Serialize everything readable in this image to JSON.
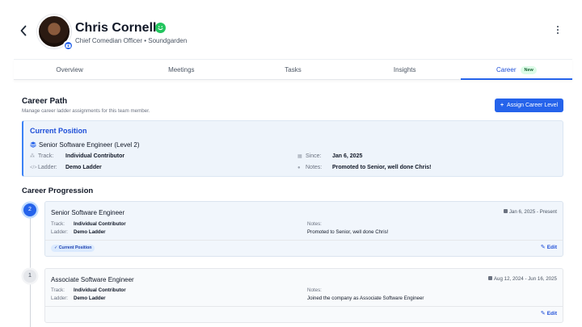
{
  "profile": {
    "name": "Chris Cornell",
    "subtitle": "Chief Comedian Officer • Soundgarden"
  },
  "tabs": [
    {
      "label": "Overview"
    },
    {
      "label": "Meetings"
    },
    {
      "label": "Tasks"
    },
    {
      "label": "Insights"
    },
    {
      "label": "Career",
      "badge": "New",
      "active": true
    }
  ],
  "career_path": {
    "title": "Career Path",
    "subtitle": "Manage career ladder assignments for this team member.",
    "assign_button": "Assign Career Level"
  },
  "current_position": {
    "title": "Current Position",
    "level": "Senior Software Engineer (Level 2)",
    "track_label": "Track:",
    "track": "Individual Contributor",
    "ladder_label": "Ladder:",
    "ladder": "Demo Ladder",
    "since_label": "Since:",
    "since": "Jan 6, 2025",
    "notes_label": "Notes:",
    "notes": "Promoted to Senior, well done Chris!"
  },
  "progression": {
    "title": "Career Progression",
    "items": [
      {
        "step": "2",
        "role": "Senior Software Engineer",
        "dates": "Jan 6, 2025 - Present",
        "track_label": "Track:",
        "track": "Individual Contributor",
        "ladder_label": "Ladder:",
        "ladder": "Demo Ladder",
        "notes_label": "Notes:",
        "notes": "Promoted to Senior, well done Chris!",
        "badge": "Current Position",
        "edit": "Edit"
      },
      {
        "step": "1",
        "role": "Associate Software Engineer",
        "dates": "Aug 12, 2024 - Jun 16, 2025",
        "track_label": "Track:",
        "track": "Individual Contributor",
        "ladder_label": "Ladder:",
        "ladder": "Demo Ladder",
        "notes_label": "Notes:",
        "notes": "Joined the company as Associate Software Engineer",
        "edit": "Edit"
      }
    ]
  },
  "colors": {
    "accent": "#2563eb",
    "success": "#22c55e",
    "current_bg": "#eef4fb"
  },
  "icons": [
    "back-icon",
    "camera-icon",
    "smile-icon",
    "more-vertical-icon",
    "plus-icon",
    "layers-icon",
    "sitemap-icon",
    "code-icon",
    "calendar-icon",
    "info-icon",
    "check-icon",
    "edit-icon"
  ]
}
